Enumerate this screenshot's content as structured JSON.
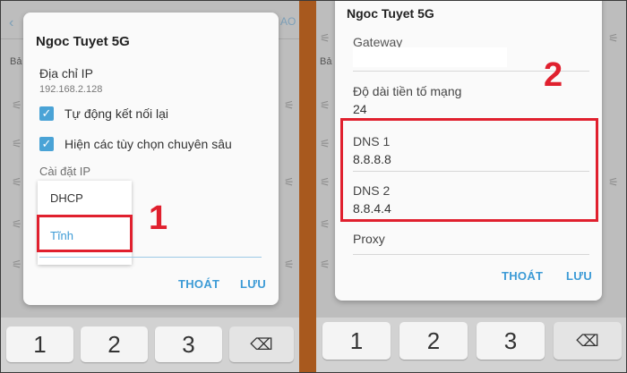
{
  "left": {
    "dialog_title": "Ngoc Tuyet 5G",
    "ip_label": "Địa chỉ IP",
    "ip_value": "192.168.2.128",
    "auto_reconnect_label": "Tự động kết nối lại",
    "advanced_options_label": "Hiện các tùy chọn chuyên sâu",
    "ip_settings_label": "Cài đặt IP",
    "ip_options": [
      "DHCP",
      "Tĩnh"
    ],
    "cancel_label": "THOÁT",
    "save_label": "LƯU",
    "step_number": "1",
    "bg_fragment_right": "AO",
    "bg_fragment_left": "Bả",
    "keys": [
      "1",
      "2",
      "3"
    ]
  },
  "right": {
    "dialog_title": "Ngoc Tuyet 5G",
    "gateway_label": "Gateway",
    "prefix_label": "Độ dài tiền tố mạng",
    "prefix_value": "24",
    "dns1_label": "DNS 1",
    "dns1_value": "8.8.8.8",
    "dns2_label": "DNS 2",
    "dns2_value": "8.8.4.4",
    "proxy_label": "Proxy",
    "cancel_label": "THOÁT",
    "save_label": "LƯU",
    "step_number": "2",
    "bg_fragment_left": "Bả",
    "keys": [
      "1",
      "2",
      "3"
    ]
  },
  "colors": {
    "accent": "#3d9bd6",
    "highlight": "#e0202e",
    "divider": "#a8591e"
  },
  "icons": {
    "checkbox": "check-icon",
    "backspace": "backspace-icon",
    "wifi": "wifi-icon"
  }
}
